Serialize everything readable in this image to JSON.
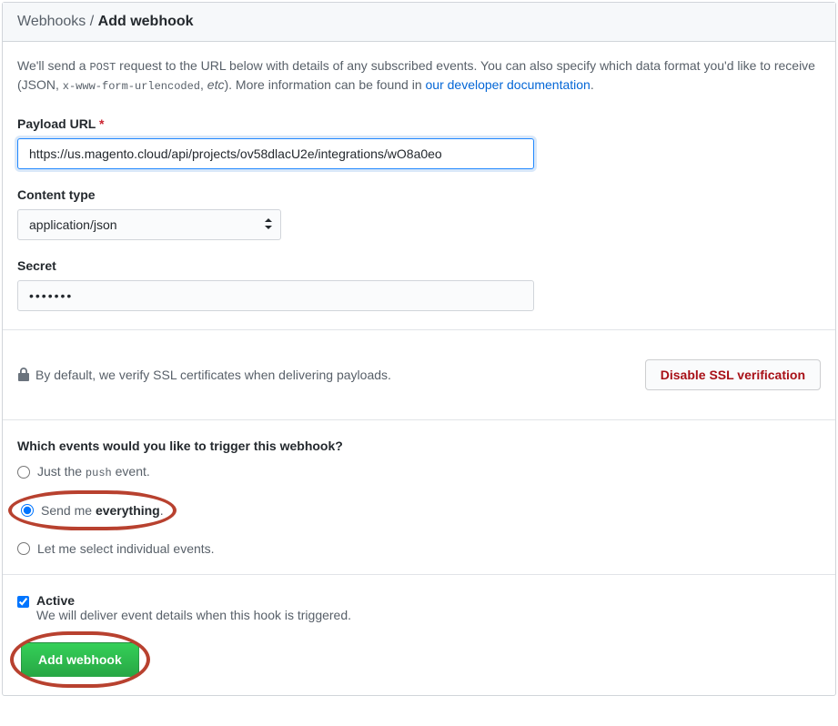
{
  "breadcrumb": {
    "parent": "Webhooks",
    "separator": " / ",
    "current": "Add webhook"
  },
  "intro": {
    "text1": "We'll send a ",
    "code1": "POST",
    "text2": " request to the URL below with details of any subscribed events. You can also specify which data format you'd like to receive (JSON, ",
    "code2": "x-www-form-urlencoded",
    "text3": ", ",
    "italic": "etc",
    "text4": "). More information can be found in ",
    "link_text": "our developer documentation",
    "text5": "."
  },
  "payload_url": {
    "label": "Payload URL",
    "required": "*",
    "value": "https://us.magento.cloud/api/projects/ov58dlacU2e/integrations/wO8a0eo"
  },
  "content_type": {
    "label": "Content type",
    "value": "application/json"
  },
  "secret": {
    "label": "Secret",
    "value": "•••••••"
  },
  "ssl": {
    "text": "By default, we verify SSL certificates when delivering payloads.",
    "button": "Disable SSL verification"
  },
  "events": {
    "title": "Which events would you like to trigger this webhook?",
    "option1_pre": "Just the ",
    "option1_code": "push",
    "option1_post": " event.",
    "option2_pre": "Send me ",
    "option2_strong": "everything",
    "option2_post": ".",
    "option3": "Let me select individual events."
  },
  "active": {
    "label": "Active",
    "desc": "We will deliver event details when this hook is triggered."
  },
  "submit": {
    "button": "Add webhook"
  }
}
